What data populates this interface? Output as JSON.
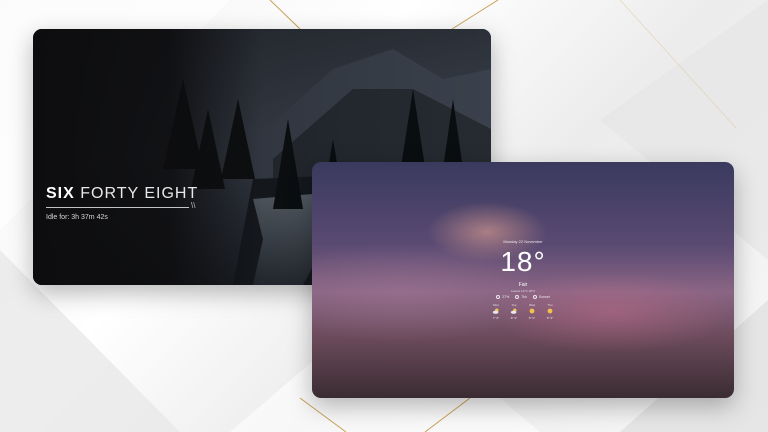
{
  "lock_screen": {
    "clock_hour": "SIX",
    "clock_minutes": "FORTY EIGHT",
    "idle_text": "Idle for: 3h 37m 42s",
    "divider_glyph": "\\\\"
  },
  "weather_screen": {
    "date": "Monday 22 November",
    "temperature": "18°",
    "condition": "Fair",
    "range": "Lowest 14°C 18°C",
    "stats": [
      {
        "icon": "drop-icon",
        "value": "27%"
      },
      {
        "icon": "wind-icon",
        "value": "7kh"
      },
      {
        "icon": "sunset-icon",
        "value": "Sunset"
      }
    ],
    "forecast": [
      {
        "day": "Mon",
        "icon": "cloud-sun-icon",
        "range": "7° 8°"
      },
      {
        "day": "Tue",
        "icon": "cloud-sun-icon",
        "range": "8° 9°"
      },
      {
        "day": "Wed",
        "icon": "sun-icon",
        "range": "8° 9°"
      },
      {
        "day": "Thu",
        "icon": "sun-icon",
        "range": "8° 9°"
      }
    ]
  },
  "colors": {
    "page_background": "#f2f2f2",
    "accent_gold": "#c9a25a",
    "lock_background": "#0d0d0f",
    "text_white": "#ffffff",
    "sun_yellow": "#f2c14a"
  }
}
